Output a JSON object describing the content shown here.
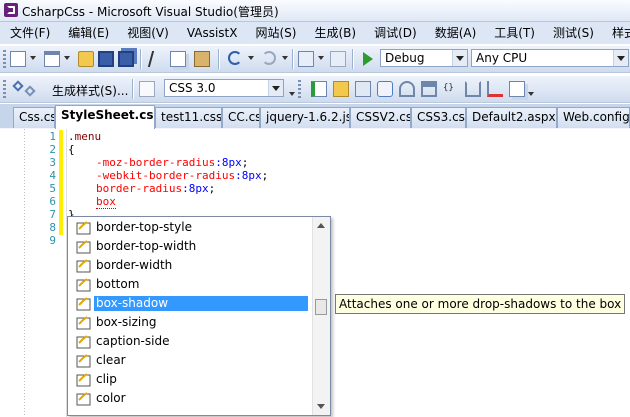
{
  "window": {
    "title": "CsharpCss - Microsoft Visual Studio(管理员)"
  },
  "menu": [
    "文件(F)",
    "编辑(E)",
    "视图(V)",
    "VAssistX",
    "网站(S)",
    "生成(B)",
    "调试(D)",
    "数据(A)",
    "工具(T)",
    "测试(S)",
    "样式(Y)"
  ],
  "toolbar1": {
    "configuration": "Debug",
    "platform": "Any CPU"
  },
  "toolbar2": {
    "build_style_label": "生成样式(S)...",
    "css_version": "CSS 3.0"
  },
  "tabs": [
    "Css.cs",
    "StyleSheet.css*",
    "test11.css",
    "CC.cs",
    "jquery-1.6.2.js",
    "CSSV2.cs",
    "CSS3.cs",
    "Default2.aspx",
    "Web.config"
  ],
  "active_tab": "StyleSheet.css*",
  "editor": {
    "line_numbers": [
      "1",
      "2",
      "3",
      "4",
      "5",
      "6",
      "7",
      "8",
      "9"
    ],
    "lines": {
      "l1": ".menu",
      "l2": "{",
      "l3_prop": "-moz-border-radius",
      "l3_val": ":8px",
      "l3_end": ";",
      "l4_prop": "-webkit-border-radius",
      "l4_val": ":8px",
      "l4_end": ";",
      "l5_prop": "border-radius",
      "l5_val": ":8px",
      "l5_end": ";",
      "l6_prop": "box",
      "l7": "}"
    }
  },
  "intellisense": {
    "items": [
      "border-top-style",
      "border-top-width",
      "border-width",
      "bottom",
      "box-shadow",
      "box-sizing",
      "caption-side",
      "clear",
      "clip",
      "color"
    ],
    "selected": "box-shadow",
    "tooltip": "Attaches one or more drop-shadows to the box"
  }
}
